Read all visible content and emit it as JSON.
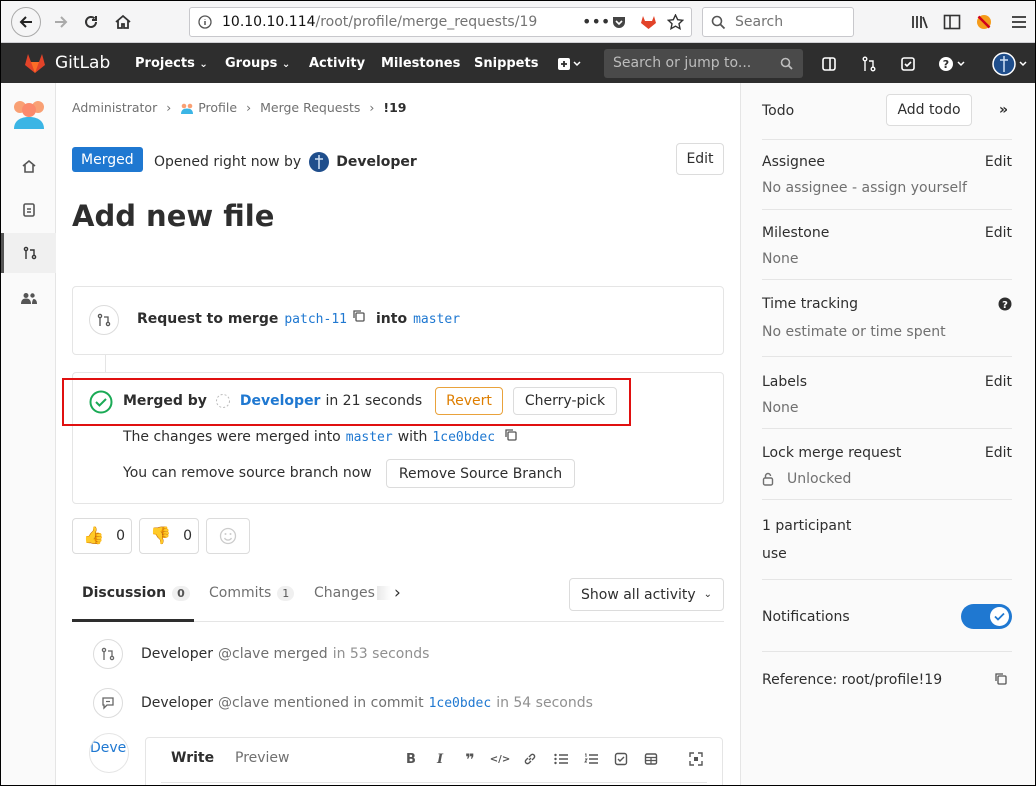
{
  "browser": {
    "url_host": "10.10.10.114",
    "url_path": "/root/profile/merge_requests/19",
    "search_placeholder": "Search"
  },
  "navbar": {
    "brand": "GitLab",
    "links": [
      "Projects",
      "Groups",
      "Activity",
      "Milestones",
      "Snippets"
    ],
    "search_placeholder": "Search or jump to..."
  },
  "breadcrumb": {
    "items": [
      "Administrator",
      "Profile",
      "Merge Requests",
      "!19"
    ]
  },
  "mr": {
    "status_badge": "Merged",
    "opened_text": "Opened right now by",
    "author": "Developer",
    "edit_label": "Edit",
    "title": "Add new file",
    "request_prefix": "Request to merge",
    "source_branch": "patch-11",
    "into": "into",
    "target_branch": "master"
  },
  "merged_widget": {
    "merged_by": "Merged by",
    "user": "Developer",
    "time": "in 21 seconds",
    "revert_label": "Revert",
    "cherry_pick_label": "Cherry-pick",
    "changes_prefix": "The changes were merged into",
    "target_branch": "master",
    "with": "with",
    "commit": "1ce0bdec",
    "remove_text": "You can remove source branch now",
    "remove_button": "Remove Source Branch"
  },
  "awards": {
    "thumbs_up": "0",
    "thumbs_down": "0"
  },
  "tabs": {
    "discussion": "Discussion",
    "discussion_count": "0",
    "commits": "Commits",
    "commits_count": "1",
    "changes": "Changes",
    "filter": "Show all activity"
  },
  "activity": [
    {
      "user": "Developer",
      "text": "@clave merged",
      "time": "in 53 seconds"
    },
    {
      "user": "Developer",
      "text": "@clave mentioned in commit",
      "commit": "1ce0bdec",
      "time": "in 54 seconds"
    }
  ],
  "comment": {
    "avatar_text": "Deve",
    "write": "Write",
    "preview": "Preview"
  },
  "sidebar": {
    "todo_label": "Todo",
    "add_todo": "Add todo",
    "assignee_label": "Assignee",
    "assignee_value": "No assignee - assign yourself",
    "milestone_label": "Milestone",
    "milestone_value": "None",
    "time_label": "Time tracking",
    "time_value": "No estimate or time spent",
    "labels_label": "Labels",
    "labels_value": "None",
    "lock_label": "Lock merge request",
    "lock_value": "Unlocked",
    "participants_label": "1 participant",
    "participant_name": "use",
    "notifications_label": "Notifications",
    "reference": "Reference: root/profile!19",
    "edit": "Edit"
  },
  "colors": {
    "accent": "#1f78d1",
    "navbar": "#2e2e2e",
    "success": "#1aaa55",
    "warning": "#e9a23b",
    "highlight_box": "#e01010"
  }
}
